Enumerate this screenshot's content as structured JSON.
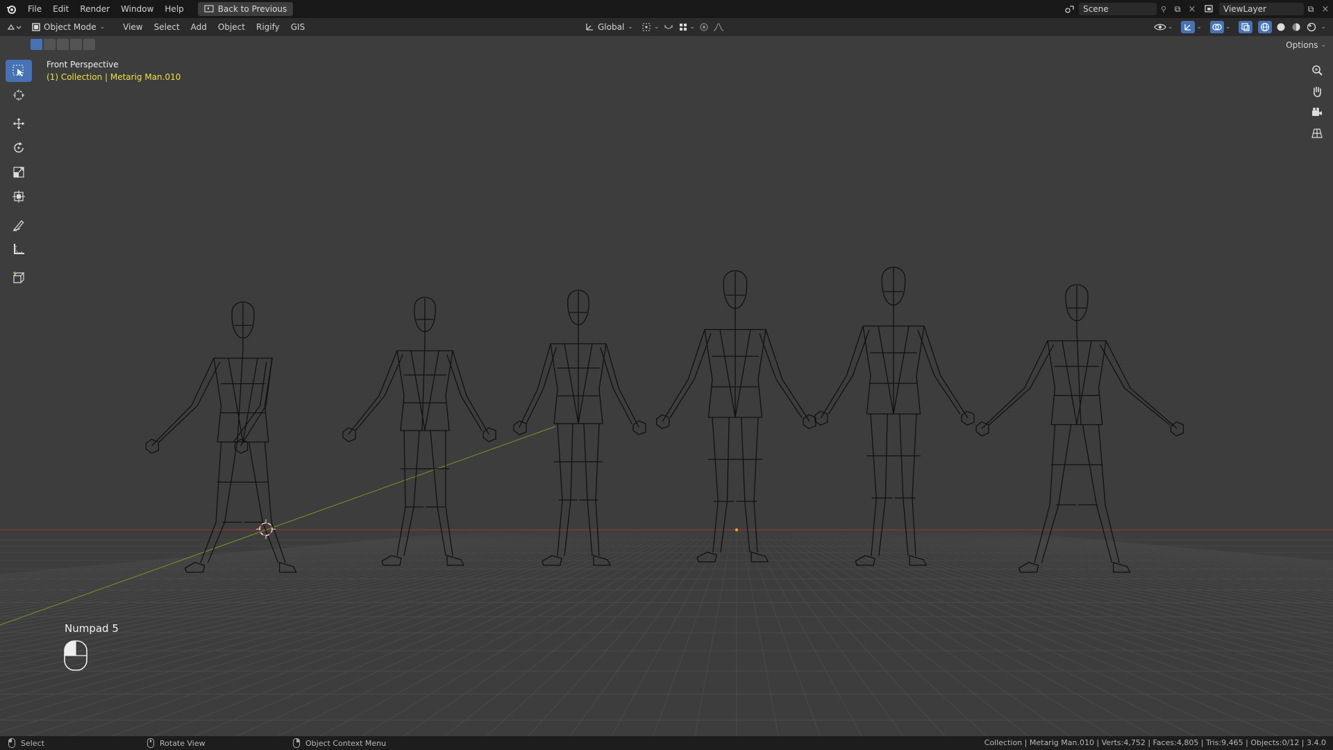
{
  "topbar": {
    "menu": [
      "File",
      "Edit",
      "Render",
      "Window",
      "Help"
    ],
    "back_button": "Back to Previous",
    "scene": "Scene",
    "view_layer": "ViewLayer"
  },
  "header": {
    "mode": "Object Mode",
    "menus": [
      "View",
      "Select",
      "Add",
      "Object",
      "Rigify",
      "GIS"
    ],
    "transform_orientation": "Global",
    "options_label": "Options"
  },
  "viewport": {
    "view_name": "Front Perspective",
    "collection_info": "(1) Collection | Metarig Man.010",
    "key_hint": "Numpad 5",
    "figure_count": 6
  },
  "status": {
    "left_action": "Select",
    "middle_action": "Rotate View",
    "right_action": "Object Context Menu",
    "stats": "Collection | Metarig Man.010 | Verts:4,752 | Faces:4,805 | Tris:9,465 | Objects:0/12 | 3.4.0"
  },
  "colors": {
    "accent": "#4772b3",
    "collection_text": "#e8e049",
    "x_axis": "#8c3a3a",
    "y_axis": "#6b8a2e"
  }
}
